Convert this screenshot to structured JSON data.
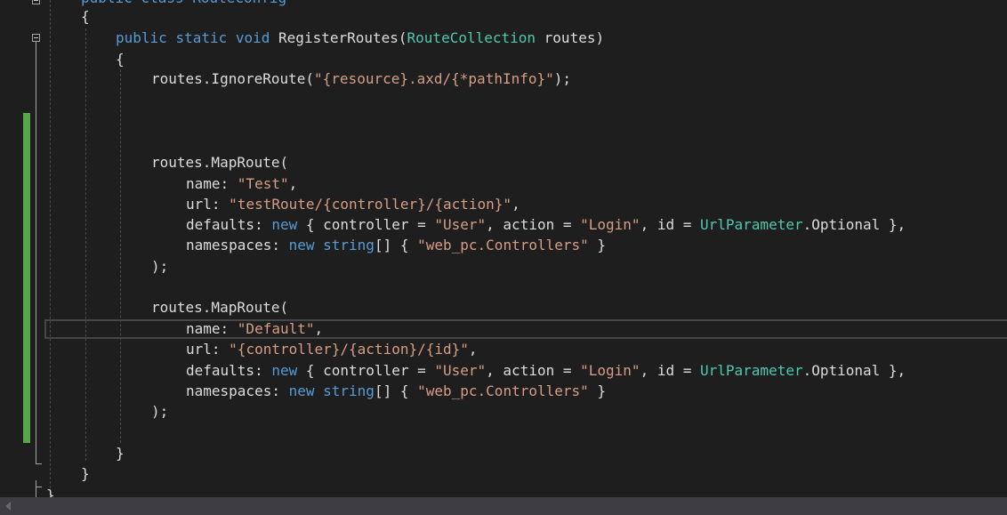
{
  "editor": {
    "lines": [
      {
        "segments": [
          {
            "t": "public class RouteConfig",
            "c": "partial"
          }
        ]
      },
      {
        "segments": [
          {
            "t": "{",
            "c": "plain"
          }
        ]
      },
      {
        "segments": [
          {
            "t": "public",
            "c": "kw"
          },
          {
            "t": " ",
            "c": "plain"
          },
          {
            "t": "static",
            "c": "kw"
          },
          {
            "t": " ",
            "c": "plain"
          },
          {
            "t": "void",
            "c": "kw"
          },
          {
            "t": " RegisterRoutes(",
            "c": "plain"
          },
          {
            "t": "RouteCollection",
            "c": "typ"
          },
          {
            "t": " routes)",
            "c": "plain"
          }
        ]
      },
      {
        "segments": [
          {
            "t": "{",
            "c": "plain"
          }
        ]
      },
      {
        "segments": [
          {
            "t": "routes.IgnoreRoute(",
            "c": "plain"
          },
          {
            "t": "\"{resource}.axd/{*pathInfo}\"",
            "c": "str"
          },
          {
            "t": ");",
            "c": "plain"
          }
        ]
      },
      {
        "segments": [
          {
            "t": "routes.MapRoute(",
            "c": "plain"
          }
        ]
      },
      {
        "segments": [
          {
            "t": "name: ",
            "c": "plain"
          },
          {
            "t": "\"Test\"",
            "c": "str"
          },
          {
            "t": ",",
            "c": "plain"
          }
        ]
      },
      {
        "segments": [
          {
            "t": "url: ",
            "c": "plain"
          },
          {
            "t": "\"testRoute/{controller}/{action}\"",
            "c": "str"
          },
          {
            "t": ",",
            "c": "plain"
          }
        ]
      },
      {
        "segments": [
          {
            "t": "defaults: ",
            "c": "plain"
          },
          {
            "t": "new",
            "c": "kw"
          },
          {
            "t": " { controller = ",
            "c": "plain"
          },
          {
            "t": "\"User\"",
            "c": "str"
          },
          {
            "t": ", action = ",
            "c": "plain"
          },
          {
            "t": "\"Login\"",
            "c": "str"
          },
          {
            "t": ", id = ",
            "c": "plain"
          },
          {
            "t": "UrlParameter",
            "c": "typ"
          },
          {
            "t": ".Optional },",
            "c": "plain"
          }
        ]
      },
      {
        "segments": [
          {
            "t": "namespaces: ",
            "c": "plain"
          },
          {
            "t": "new",
            "c": "kw"
          },
          {
            "t": " ",
            "c": "plain"
          },
          {
            "t": "string",
            "c": "kw"
          },
          {
            "t": "[] { ",
            "c": "plain"
          },
          {
            "t": "\"web_pc.Controllers\"",
            "c": "str"
          },
          {
            "t": " }",
            "c": "plain"
          }
        ]
      },
      {
        "segments": [
          {
            "t": ");",
            "c": "plain"
          }
        ]
      },
      {
        "segments": [
          {
            "t": "routes.MapRoute(",
            "c": "plain"
          }
        ]
      },
      {
        "segments": [
          {
            "t": "name: ",
            "c": "plain"
          },
          {
            "t": "\"Default\"",
            "c": "str"
          },
          {
            "t": ",",
            "c": "plain"
          }
        ]
      },
      {
        "segments": [
          {
            "t": "url: ",
            "c": "plain"
          },
          {
            "t": "\"{controller}/{action}/{id}\"",
            "c": "str"
          },
          {
            "t": ",",
            "c": "plain"
          }
        ]
      },
      {
        "segments": [
          {
            "t": "defaults: ",
            "c": "plain"
          },
          {
            "t": "new",
            "c": "kw"
          },
          {
            "t": " { controller = ",
            "c": "plain"
          },
          {
            "t": "\"User\"",
            "c": "str"
          },
          {
            "t": ", action = ",
            "c": "plain"
          },
          {
            "t": "\"Login\"",
            "c": "str"
          },
          {
            "t": ", id = ",
            "c": "plain"
          },
          {
            "t": "UrlParameter",
            "c": "typ"
          },
          {
            "t": ".Optional },",
            "c": "plain"
          }
        ]
      },
      {
        "segments": [
          {
            "t": "namespaces: ",
            "c": "plain"
          },
          {
            "t": "new",
            "c": "kw"
          },
          {
            "t": " ",
            "c": "plain"
          },
          {
            "t": "string",
            "c": "kw"
          },
          {
            "t": "[] { ",
            "c": "plain"
          },
          {
            "t": "\"web_pc.Controllers\"",
            "c": "str"
          },
          {
            "t": " }",
            "c": "plain"
          }
        ]
      },
      {
        "segments": [
          {
            "t": ");",
            "c": "plain"
          }
        ]
      },
      {
        "segments": [
          {
            "t": "}",
            "c": "plain"
          }
        ]
      },
      {
        "segments": [
          {
            "t": "}",
            "c": "plain"
          }
        ]
      },
      {
        "segments": [
          {
            "t": "}",
            "c": "plain"
          }
        ]
      }
    ]
  },
  "colors": {
    "background": "#1e1e1e",
    "keyword": "#569cd6",
    "string": "#d69d85",
    "type": "#4ec9b0",
    "text": "#dcdcdc",
    "change_marker": "#57a64a"
  },
  "icons": {
    "fold_marker": "collapse-minus-icon",
    "scroll_left": "scroll-left-arrow-icon"
  }
}
